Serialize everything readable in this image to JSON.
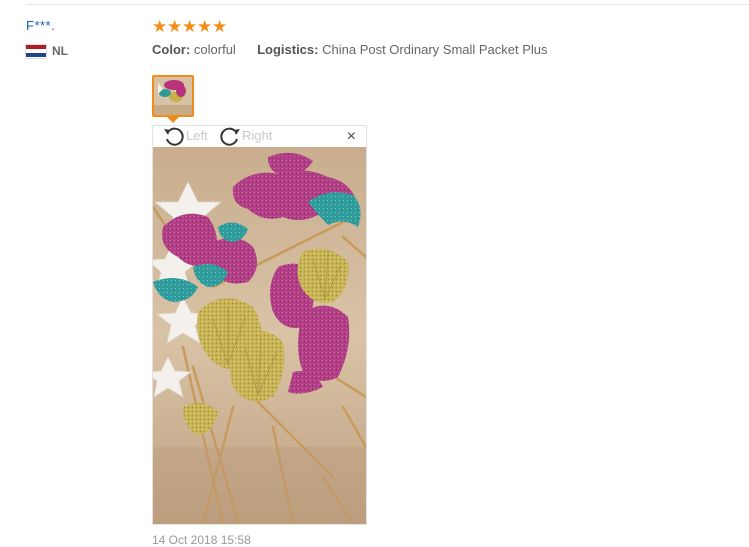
{
  "buyer": {
    "name": "F***.",
    "country_code": "NL",
    "flag_colors": [
      "#ae1c28",
      "#ffffff",
      "#21468b"
    ]
  },
  "review": {
    "rating": 5,
    "max_rating": 5,
    "star_color": "#f28d18",
    "color_label": "Color:",
    "color_value": "colorful",
    "logistics_label": "Logistics:",
    "logistics_value": "China Post Ordinary Small Packet Plus"
  },
  "viewer": {
    "rotate_left_label": "Left",
    "rotate_right_label": "Right",
    "close_glyph": "×",
    "accent": "#f08c1d"
  },
  "date": "14 Oct 2018 15:58"
}
